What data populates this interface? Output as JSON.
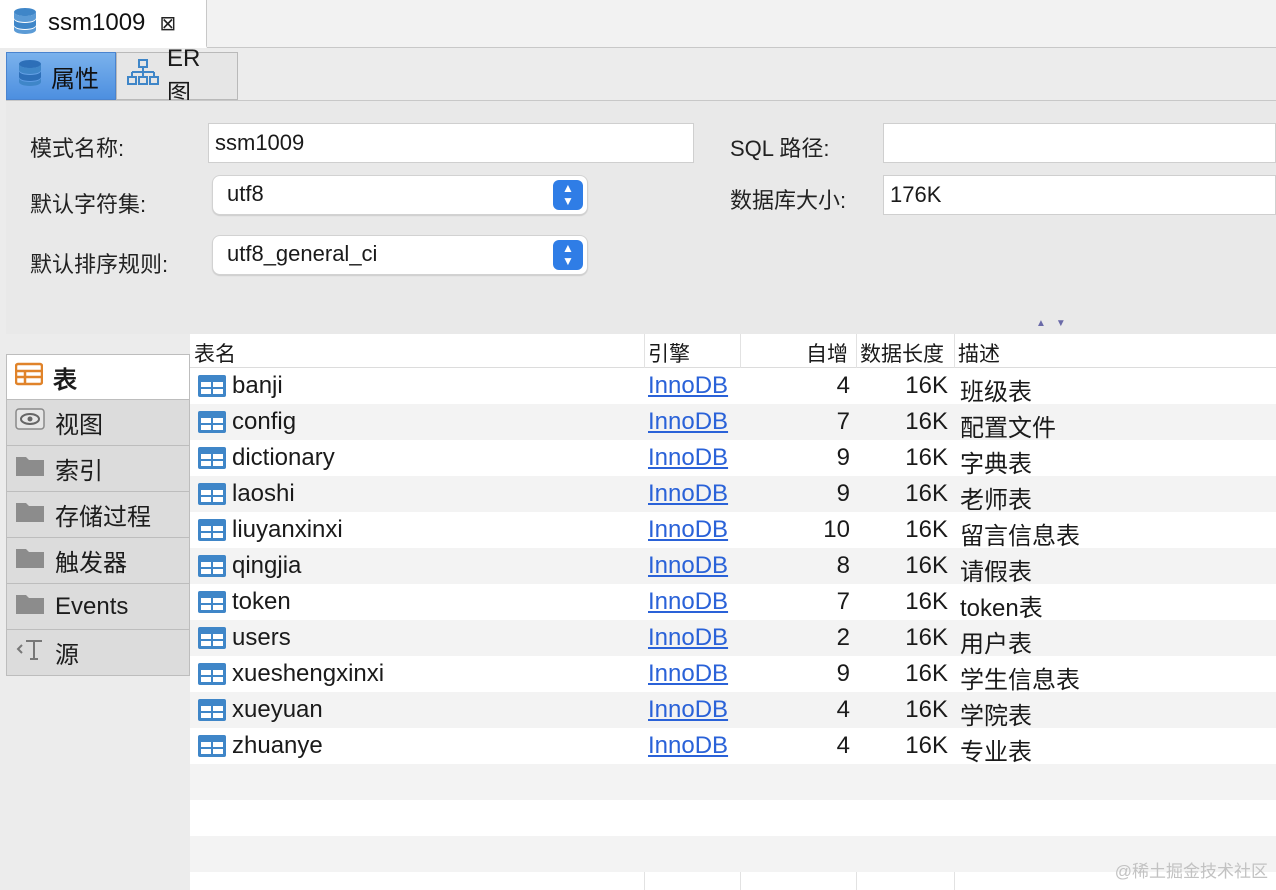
{
  "editor_tab": {
    "title": "ssm1009",
    "close": "⊠"
  },
  "sub_tabs": {
    "properties": "属性",
    "er": "ER 图"
  },
  "form": {
    "schema_name_label": "模式名称:",
    "schema_name_value": "ssm1009",
    "charset_label": "默认字符集:",
    "charset_value": "utf8",
    "collation_label": "默认排序规则:",
    "collation_value": "utf8_general_ci",
    "sql_path_label": "SQL 路径:",
    "sql_path_value": "",
    "db_size_label": "数据库大小:",
    "db_size_value": "176K"
  },
  "categories": [
    {
      "label": "表",
      "icon": "table-category-icon",
      "active": true
    },
    {
      "label": "视图",
      "icon": "eye-icon",
      "active": false
    },
    {
      "label": "索引",
      "icon": "folder-icon",
      "active": false
    },
    {
      "label": "存储过程",
      "icon": "folder-icon",
      "active": false
    },
    {
      "label": "触发器",
      "icon": "folder-icon",
      "active": false
    },
    {
      "label": "Events",
      "icon": "folder-icon",
      "active": false
    },
    {
      "label": "源",
      "icon": "source-icon",
      "active": false
    }
  ],
  "table_grid": {
    "headers": {
      "name": "表名",
      "engine": "引擎",
      "auto_increment": "自增",
      "data_length": "数据长度",
      "comment": "描述"
    },
    "rows": [
      {
        "name": "banji",
        "engine": "InnoDB",
        "auto_increment": "4",
        "data_length": "16K",
        "comment": "班级表"
      },
      {
        "name": "config",
        "engine": "InnoDB",
        "auto_increment": "7",
        "data_length": "16K",
        "comment": "配置文件"
      },
      {
        "name": "dictionary",
        "engine": "InnoDB",
        "auto_increment": "9",
        "data_length": "16K",
        "comment": "字典表"
      },
      {
        "name": "laoshi",
        "engine": "InnoDB",
        "auto_increment": "9",
        "data_length": "16K",
        "comment": "老师表"
      },
      {
        "name": "liuyanxinxi",
        "engine": "InnoDB",
        "auto_increment": "10",
        "data_length": "16K",
        "comment": "留言信息表"
      },
      {
        "name": "qingjia",
        "engine": "InnoDB",
        "auto_increment": "8",
        "data_length": "16K",
        "comment": "请假表"
      },
      {
        "name": "token",
        "engine": "InnoDB",
        "auto_increment": "7",
        "data_length": "16K",
        "comment": "token表"
      },
      {
        "name": "users",
        "engine": "InnoDB",
        "auto_increment": "2",
        "data_length": "16K",
        "comment": "用户表"
      },
      {
        "name": "xueshengxinxi",
        "engine": "InnoDB",
        "auto_increment": "9",
        "data_length": "16K",
        "comment": "学生信息表"
      },
      {
        "name": "xueyuan",
        "engine": "InnoDB",
        "auto_increment": "4",
        "data_length": "16K",
        "comment": "学院表"
      },
      {
        "name": "zhuanye",
        "engine": "InnoDB",
        "auto_increment": "4",
        "data_length": "16K",
        "comment": "专业表"
      }
    ]
  },
  "watermark": "@稀土掘金技术社区",
  "colors": {
    "accent": "#2f7de6",
    "link": "#2a62d8",
    "table_icon": "#3f86c8"
  }
}
